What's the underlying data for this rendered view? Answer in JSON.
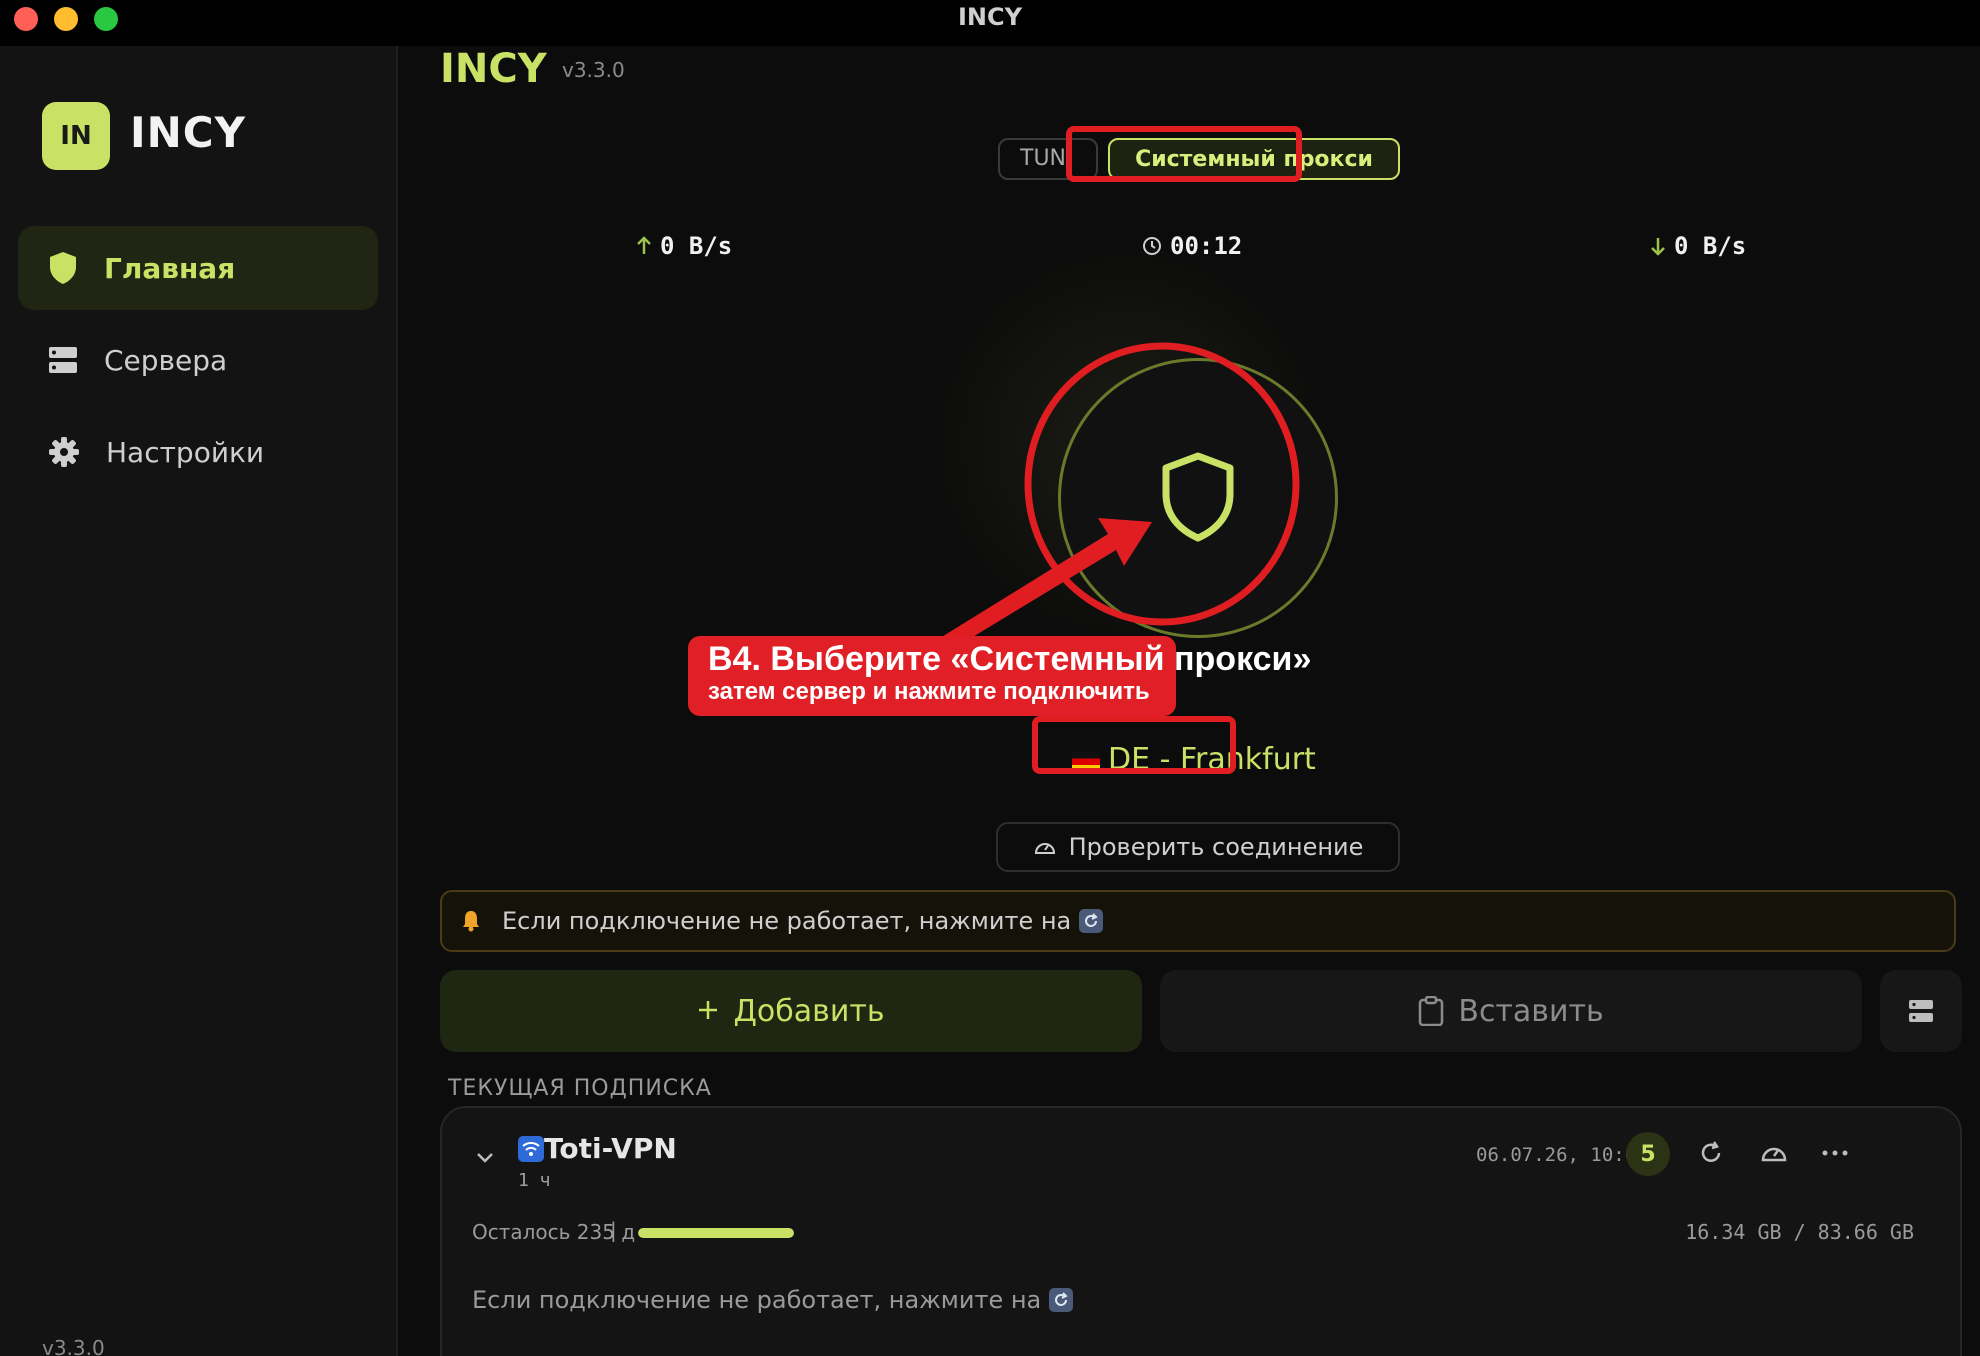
{
  "window": {
    "title": "INCY"
  },
  "sidebar": {
    "logo_badge": "IN",
    "logo_text": "INCY",
    "items": [
      {
        "label": "Главная",
        "icon": "shield-icon",
        "active": true
      },
      {
        "label": "Сервера",
        "icon": "server-icon",
        "active": false
      },
      {
        "label": "Настройки",
        "icon": "gear-icon",
        "active": false
      }
    ],
    "version": "v3.3.0"
  },
  "header": {
    "title": "INCY",
    "version": "v3.3.0"
  },
  "mode": {
    "tun_label": "TUN",
    "proxy_label": "Системный прокси",
    "selected": "proxy"
  },
  "stats": {
    "upload": "0 B/s",
    "timer": "00:12",
    "download": "0 B/s"
  },
  "callout": {
    "title": "B4. Выберите «Системный прокси»",
    "subtitle": "затем сервер и нажмите подключить"
  },
  "server": {
    "flag": "DE",
    "name": "DE - Frankfurt"
  },
  "check_button": "Проверить соединение",
  "notice": {
    "text": "Если подключение не работает, нажмите на"
  },
  "actions": {
    "add_label": "Добавить",
    "paste_label": "Вставить"
  },
  "subscription": {
    "section_label": "ТЕКУЩАЯ ПОДПИСКА",
    "name": "Toti-VPN",
    "interval": "1 ч",
    "date": "06.07.26, 10:06",
    "count": "5",
    "remaining": "Осталось 235 д",
    "separator": "|",
    "traffic": "16.34 GB / 83.66 GB",
    "usage_fraction": 1.0,
    "message": "Если подключение не работает, нажмите на"
  },
  "colors": {
    "accent": "#c9e265",
    "highlight_red": "#e01e22",
    "notice_border": "#4b3a16"
  }
}
